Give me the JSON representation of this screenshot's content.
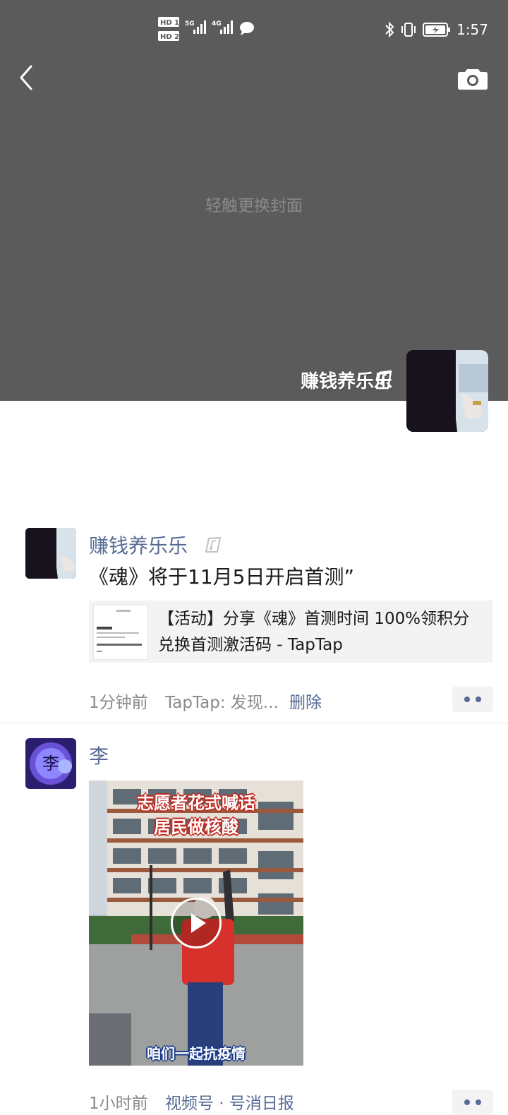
{
  "status_bar": {
    "time": "1:57",
    "sim1_label": "HD 1",
    "sim2_label": "HD 2",
    "net1": "5G",
    "net2": "4G"
  },
  "header": {
    "back_icon": "chevron-left-icon",
    "camera_icon": "camera-icon"
  },
  "cover": {
    "hint": "轻触更换封面",
    "background_color": "#5b5b5b"
  },
  "profile": {
    "name": "赚钱养乐乐",
    "badge_icon": "music-note-badge-icon"
  },
  "posts": [
    {
      "author": "赚钱养乐乐",
      "text": "《魂》将于11月5日开启首测”",
      "link_title": "【活动】分享《魂》首测时间 100%领积分兑换首测激活码 - TapTap",
      "time": "1分钟前",
      "source": "TapTap: 发现...",
      "delete_label": "删除"
    },
    {
      "author": "李",
      "avatar_char": "李",
      "video_caption_line1": "志愿者花式喊话",
      "video_caption_line2": "居民做核酸",
      "video_caption_bottom": "咱们一起抗疫情",
      "time": "1小时前",
      "source": "视频号 · 号消日报"
    }
  ],
  "colors": {
    "link_blue": "#576b95",
    "meta_gray": "#8a8a8a"
  }
}
